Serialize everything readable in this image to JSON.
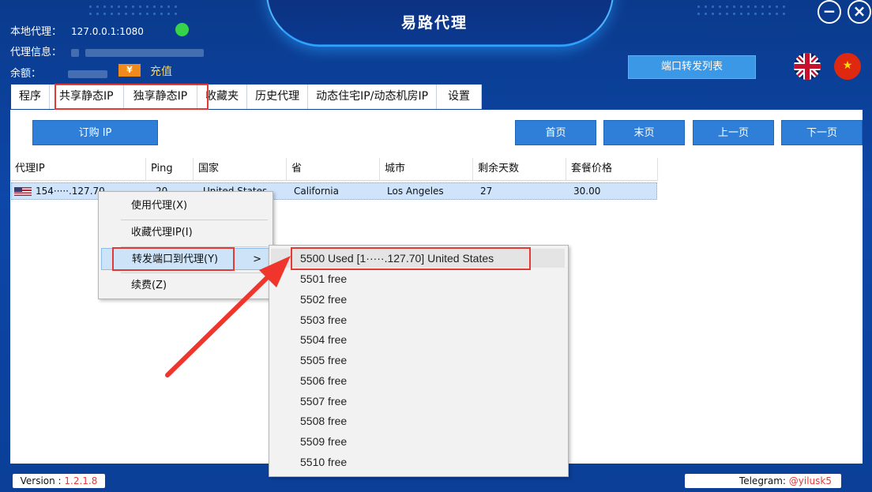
{
  "app": {
    "title": "易路代理"
  },
  "window_controls": {
    "minimize": "−",
    "close": "×"
  },
  "info": {
    "local_proxy_label": "本地代理：",
    "local_proxy_value": "127.0.0.1:1080",
    "proxy_info_label": "代理信息：",
    "balance_label": "余额：",
    "yen_symbol": "¥",
    "recharge": "充值"
  },
  "header": {
    "port_forward_list": "端口转发列表"
  },
  "tabs": [
    {
      "label": "程序"
    },
    {
      "label": "共享静态IP"
    },
    {
      "label": "独享静态IP"
    },
    {
      "label": "收藏夹"
    },
    {
      "label": "历史代理"
    },
    {
      "label": "动态住宅IP/动态机房IP"
    },
    {
      "label": "设置"
    }
  ],
  "toolbar": {
    "buy_ip": "订购 IP",
    "first_page": "首页",
    "last_page": "末页",
    "prev_page": "上一页",
    "next_page": "下一页"
  },
  "table": {
    "columns": [
      "代理IP",
      "Ping",
      "国家",
      "省",
      "城市",
      "剩余天数",
      "套餐价格"
    ],
    "rows": [
      {
        "ip": "154·····.127.70",
        "ping": "20",
        "country": "United States",
        "province": "California",
        "city": "Los Angeles",
        "days": "27",
        "price": "30.00"
      }
    ]
  },
  "context_menu": {
    "items": [
      {
        "label": "使用代理(X)"
      },
      {
        "label": "收藏代理IP(I)"
      },
      {
        "label": "转发端口到代理(Y)"
      },
      {
        "label": "续费(Z)"
      }
    ],
    "submenu_arrow": ">"
  },
  "submenu": {
    "items": [
      {
        "label": "5500 Used [1·····.127.70] United States"
      },
      {
        "label": "5501 free"
      },
      {
        "label": "5502 free"
      },
      {
        "label": "5503 free"
      },
      {
        "label": "5504 free"
      },
      {
        "label": "5505 free"
      },
      {
        "label": "5506 free"
      },
      {
        "label": "5507 free"
      },
      {
        "label": "5508 free"
      },
      {
        "label": "5509 free"
      },
      {
        "label": "5510 free"
      }
    ]
  },
  "status": {
    "version_label": "Version :",
    "version_value": "1.2.1.8",
    "telegram_label": "Telegram:",
    "telegram_value": "@yilusk5"
  },
  "colors": {
    "accent": "#2f7fd8",
    "highlight_box": "#e53935",
    "arrow": "#f0352c"
  }
}
